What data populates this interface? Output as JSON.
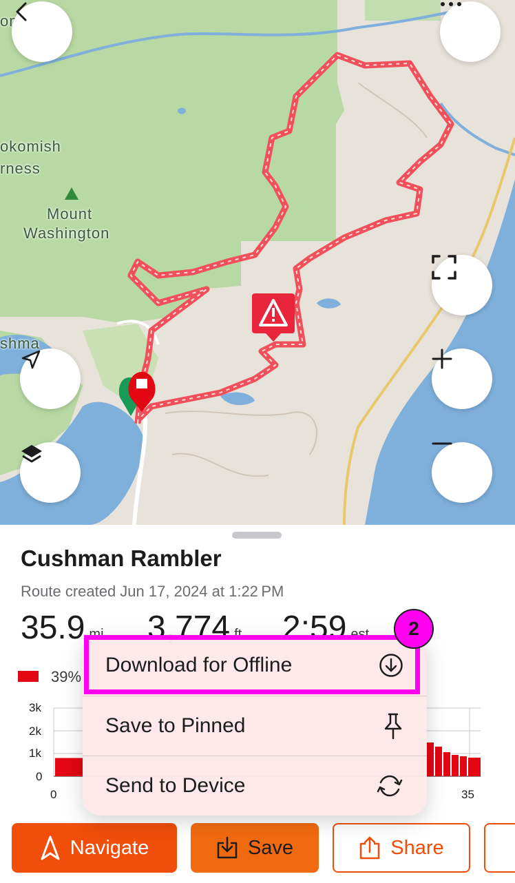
{
  "map": {
    "labels": {
      "skokomish": "okomish",
      "wilderness": "rness",
      "mount": "Mount",
      "washington": "Washington",
      "cushman": "shma",
      "top_left": "om"
    },
    "colors": {
      "route": "#f0505a",
      "forest": "#b8d9a3",
      "water": "#7fb0dc",
      "land": "#e8e3da",
      "warning": "#e8253a"
    },
    "icons": {
      "back": "chevron-left-icon",
      "more": "ellipsis-icon",
      "fullscreen": "fullscreen-icon",
      "zoom_in": "plus-icon",
      "zoom_out": "minus-icon",
      "locate": "location-arrow-icon",
      "layers": "layers-icon",
      "warning": "warning-icon"
    }
  },
  "route": {
    "title": "Cushman Rambler",
    "subtitle": "Route created Jun 17, 2024 at 1:22 PM",
    "stats": [
      {
        "value": "35.9",
        "unit": "mi"
      },
      {
        "value": "3,774",
        "unit": "ft"
      },
      {
        "value": "2:59",
        "unit": "est"
      }
    ],
    "surface_legend": {
      "percent": "39%",
      "color": "#e30613"
    }
  },
  "elevation_chart": {
    "y_ticks": [
      "3k",
      "2k",
      "1k",
      "0"
    ],
    "x_ticks": [
      "0",
      "35"
    ],
    "bar_color": "#e30613"
  },
  "menu": {
    "items": [
      {
        "label": "Download for Offline",
        "icon": "download-circle-icon"
      },
      {
        "label": "Save to Pinned",
        "icon": "pin-icon"
      },
      {
        "label": "Send to Device",
        "icon": "sync-icon"
      }
    ]
  },
  "annotation": {
    "step": "2",
    "color": "#ff00f0"
  },
  "actions": {
    "navigate": "Navigate",
    "save": "Save",
    "share": "Share"
  }
}
